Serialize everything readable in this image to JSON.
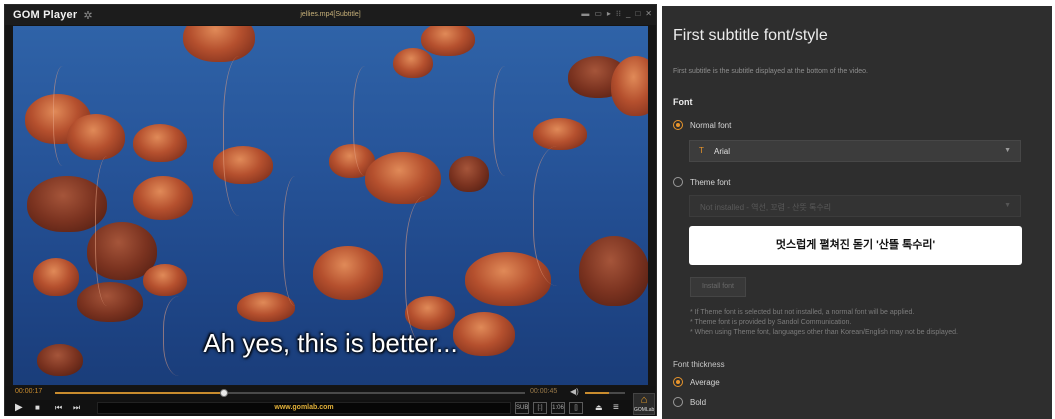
{
  "player": {
    "logo": "GOM Player",
    "window_title": "jellies.mp4[Subtitle]",
    "subtitle_text": "Ah yes, this is better...",
    "time_current": "00:00:17",
    "time_total": "00:00:45",
    "progress_fraction": 0.36,
    "volume_fraction": 0.6,
    "url": "www.gomlab.com",
    "home_label": "GOMLab",
    "subtitle_boxes": [
      "SUB",
      "[:]",
      "1:06",
      "[]"
    ]
  },
  "settings": {
    "title": "First subtitle font/style",
    "description": "First subtitle is the subtitle displayed at the bottom of the video.",
    "font_section": "Font",
    "normal_font_label": "Normal font",
    "normal_font_value": "Arial",
    "theme_font_label": "Theme font",
    "theme_font_value": "Not installed - 역선, 꼬렴 - 산뜻 톡수리",
    "preview_text": "멋스럽게 펼쳐진 돋기 '산뜰 톡수리'",
    "install_button": "Install font",
    "notes": [
      "* If Theme font is selected but not installed, a normal font will be applied.",
      "* Theme font is provided by Sandol Communication.",
      "* When using Theme font, languages other than Korean/English may not be displayed."
    ],
    "thickness_label": "Font thickness",
    "thickness_average": "Average",
    "thickness_bold": "Bold",
    "selected_font_type": "Normal font",
    "selected_thickness": "Average"
  },
  "colors": {
    "accent": "#e8952c",
    "panel_bg": "#2e2e2e",
    "player_bg": "#151515",
    "time_text": "#c98c2e"
  }
}
